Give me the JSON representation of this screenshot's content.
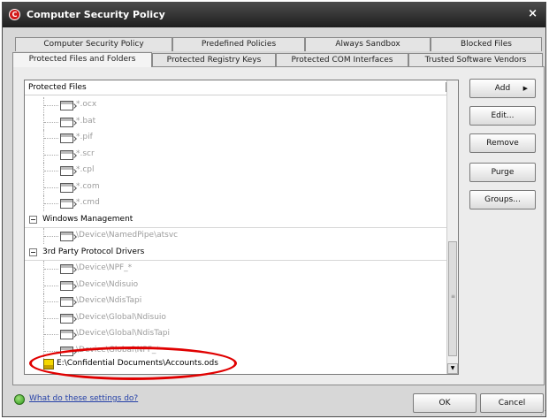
{
  "window": {
    "title": "Computer Security Policy",
    "close_glyph": "×",
    "app_glyph": "C"
  },
  "tabs": {
    "row_top": [
      "Computer Security Policy",
      "Predefined Policies",
      "Always Sandbox",
      "Blocked Files"
    ],
    "row_bottom": [
      "Protected Files and Folders",
      "Protected Registry Keys",
      "Protected COM Interfaces",
      "Trusted Software Vendors"
    ],
    "active": "Protected Files and Folders"
  },
  "list": {
    "header": "Protected Files",
    "rows": [
      {
        "kind": "item",
        "text": "*.ocx"
      },
      {
        "kind": "item",
        "text": "*.bat"
      },
      {
        "kind": "item",
        "text": "*.pif"
      },
      {
        "kind": "item",
        "text": "*.scr"
      },
      {
        "kind": "item",
        "text": "*.cpl"
      },
      {
        "kind": "item",
        "text": "*.com"
      },
      {
        "kind": "item",
        "text": "*.cmd"
      },
      {
        "kind": "group",
        "text": "Windows Management"
      },
      {
        "kind": "item",
        "text": "\\Device\\NamedPipe\\atsvc"
      },
      {
        "kind": "group",
        "text": "3rd Party Protocol Drivers"
      },
      {
        "kind": "item",
        "text": "\\Device\\NPF_*"
      },
      {
        "kind": "item",
        "text": "\\Device\\Ndisuio"
      },
      {
        "kind": "item",
        "text": "\\Device\\NdisTapi"
      },
      {
        "kind": "item",
        "text": "\\Device\\Global\\Ndisuio"
      },
      {
        "kind": "item",
        "text": "\\Device\\Global\\NdisTapi"
      },
      {
        "kind": "item",
        "text": "\\Device\\Global\\NPF_*"
      }
    ],
    "highlighted": "E:\\Confidential Documents\\Accounts.ods",
    "scroll_up_glyph": "▲",
    "scroll_down_glyph": "▼"
  },
  "side_buttons": {
    "add": "Add",
    "add_arrow": "▶",
    "edit": "Edit...",
    "remove": "Remove",
    "purge": "Purge",
    "groups": "Groups..."
  },
  "footer": {
    "help_link": "What do these settings do?",
    "ok": "OK",
    "cancel": "Cancel"
  }
}
